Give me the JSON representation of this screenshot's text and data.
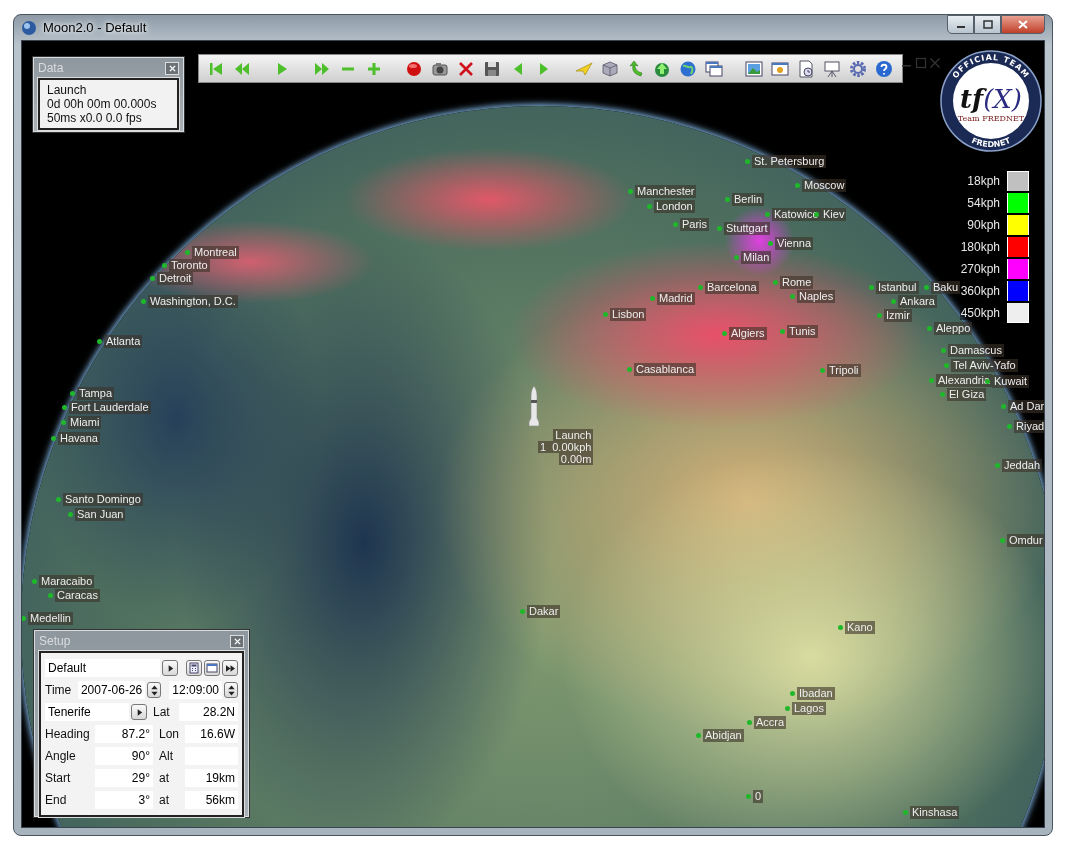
{
  "window": {
    "title": "Moon2.0 - Default"
  },
  "data_panel": {
    "title": "Data",
    "lines": [
      "Launch",
      "0d 00h 00m 00.000s",
      "50ms x0.0 0.0 fps"
    ]
  },
  "logo": {
    "top_text": "OFFICIAL TEAM",
    "mark_left": "tf",
    "mark_right": "(X)",
    "team": "Team FREDNET",
    "bottom_text": "FREDNET"
  },
  "legend": [
    {
      "label": "18kph",
      "color": "#c0c0c0"
    },
    {
      "label": "54kph",
      "color": "#00ff00"
    },
    {
      "label": "90kph",
      "color": "#ffff00"
    },
    {
      "label": "180kph",
      "color": "#ff0000"
    },
    {
      "label": "270kph",
      "color": "#ff00ff"
    },
    {
      "label": "360kph",
      "color": "#0000ff"
    },
    {
      "label": "450kph",
      "color": "#eeeeee"
    }
  ],
  "rocket": {
    "lines": [
      "Launch",
      "1  0.00kph",
      "0.00m"
    ]
  },
  "cities": [
    {
      "name": "St. Petersburg"
    },
    {
      "name": "Moscow"
    },
    {
      "name": "Manchester"
    },
    {
      "name": "Berlin"
    },
    {
      "name": "London"
    },
    {
      "name": "Katowice"
    },
    {
      "name": "Kiev"
    },
    {
      "name": "Paris"
    },
    {
      "name": "Stuttgart"
    },
    {
      "name": "Vienna"
    },
    {
      "name": "Montreal"
    },
    {
      "name": "Milan"
    },
    {
      "name": "Toronto"
    },
    {
      "name": "Detroit"
    },
    {
      "name": "Barcelona"
    },
    {
      "name": "Rome"
    },
    {
      "name": "Istanbul"
    },
    {
      "name": "Baku"
    },
    {
      "name": "Madrid"
    },
    {
      "name": "Naples"
    },
    {
      "name": "Washington, D.C."
    },
    {
      "name": "Ankara"
    },
    {
      "name": "Izmir"
    },
    {
      "name": "Lisbon"
    },
    {
      "name": "Aleppo"
    },
    {
      "name": "Algiers"
    },
    {
      "name": "Tunis"
    },
    {
      "name": "Atlanta"
    },
    {
      "name": "Damascus"
    },
    {
      "name": "Tel Aviv-Yafo"
    },
    {
      "name": "Casablanca"
    },
    {
      "name": "Tripoli"
    },
    {
      "name": "Alexandria"
    },
    {
      "name": "Kuwait"
    },
    {
      "name": "El Giza"
    },
    {
      "name": "Tampa"
    },
    {
      "name": "Ad Dar"
    },
    {
      "name": "Fort Lauderdale"
    },
    {
      "name": "Miami"
    },
    {
      "name": "Riyad"
    },
    {
      "name": "Havana"
    },
    {
      "name": "Jeddah"
    },
    {
      "name": "Santo Domingo"
    },
    {
      "name": "San Juan"
    },
    {
      "name": "Omdur"
    },
    {
      "name": "Maracaibo"
    },
    {
      "name": "Caracas"
    },
    {
      "name": "Dakar"
    },
    {
      "name": "Medellin"
    },
    {
      "name": "Kano"
    },
    {
      "name": "Ibadan"
    },
    {
      "name": "Lagos"
    },
    {
      "name": "Accra"
    },
    {
      "name": "Abidjan"
    },
    {
      "name": "0"
    },
    {
      "name": "Kinshasa"
    }
  ],
  "setup": {
    "title": "Setup",
    "preset": "Default",
    "time_label": "Time",
    "date": "2007-06-26",
    "time": "12:09:00",
    "site": "Tenerife",
    "lat_label": "Lat",
    "lat": "28.2N",
    "rows": [
      {
        "label": "Heading",
        "value": "87.2°",
        "label2": "Lon",
        "value2": "16.6W"
      },
      {
        "label": "Angle",
        "value": "90°",
        "label2": "Alt"
      },
      {
        "label": "Start",
        "value": "29°",
        "label2": "at",
        "value2": "19km"
      },
      {
        "label": "End",
        "value": "3°",
        "label2": "at",
        "value2": "56km"
      }
    ]
  }
}
